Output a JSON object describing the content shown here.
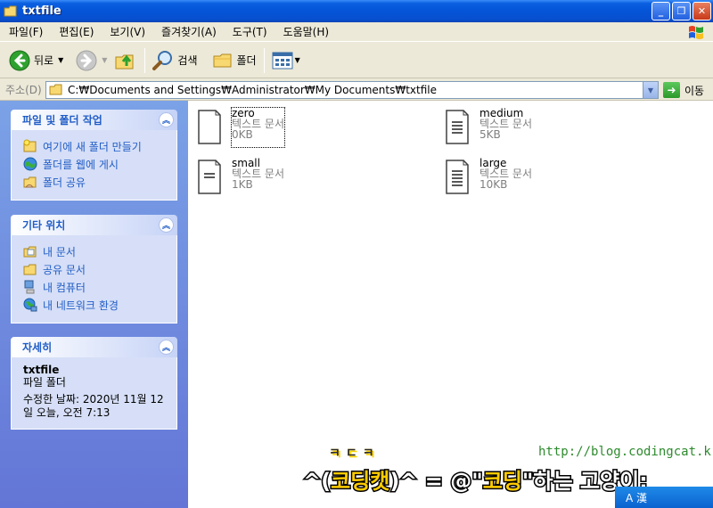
{
  "window": {
    "title": "txtfile",
    "minimize": "_",
    "maximize": "❐",
    "close": "✕"
  },
  "menu": [
    "파일(F)",
    "편집(E)",
    "보기(V)",
    "즐겨찾기(A)",
    "도구(T)",
    "도움말(H)"
  ],
  "toolbar": {
    "back_label": "뒤로",
    "search_label": "검색",
    "folders_label": "폴더"
  },
  "address": {
    "label": "주소(D)",
    "path": "C:₩Documents and Settings₩Administrator₩My Documents₩txtfile",
    "go_label": "이동"
  },
  "tasks": {
    "file_folder": {
      "title": "파일 및 폴더 작업",
      "items": [
        "여기에 새 폴더 만들기",
        "폴더를 웹에 게시",
        "폴더 공유"
      ]
    },
    "other_places": {
      "title": "기타 위치",
      "items": [
        "내 문서",
        "공유 문서",
        "내 컴퓨터",
        "내 네트워크 환경"
      ]
    },
    "details": {
      "title": "자세히",
      "name": "txtfile",
      "type": "파일 폴더",
      "modified_line1": "수정한 날짜: 2020년 11월 12",
      "modified_line2": "일 오늘, 오전 7:13"
    }
  },
  "files": [
    {
      "name": "zero",
      "type": "텍스트 문서",
      "size": "0KB",
      "selected": true,
      "lines": 0
    },
    {
      "name": "medium",
      "type": "텍스트 문서",
      "size": "5KB",
      "selected": false,
      "lines": 4
    },
    {
      "name": "small",
      "type": "텍스트 문서",
      "size": "1KB",
      "selected": false,
      "lines": 2
    },
    {
      "name": "large",
      "type": "텍스트 문서",
      "size": "10KB",
      "selected": false,
      "lines": 5
    }
  ],
  "watermark": {
    "logo": "ㅋㄷㅋ",
    "url": "http://blog.codingcat.kr/",
    "p1": "^(",
    "p2": "코딩캣",
    "p3": ")^ = @\"",
    "p4": "코딩",
    "p5": "\"하는 고양이;"
  },
  "tray": {
    "ime": "A 漢 "
  }
}
